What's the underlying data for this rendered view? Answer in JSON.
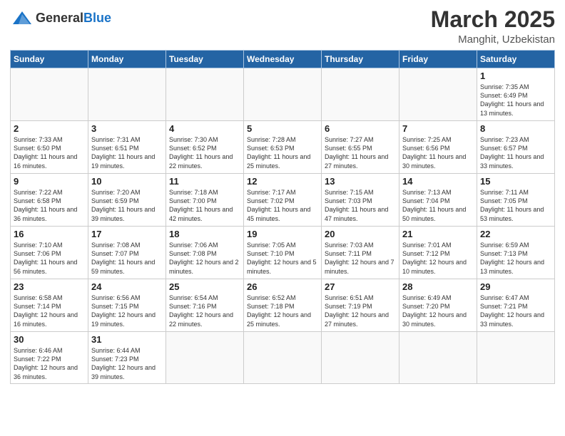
{
  "header": {
    "logo_general": "General",
    "logo_blue": "Blue",
    "month_title": "March 2025",
    "subtitle": "Manghit, Uzbekistan"
  },
  "weekdays": [
    "Sunday",
    "Monday",
    "Tuesday",
    "Wednesday",
    "Thursday",
    "Friday",
    "Saturday"
  ],
  "weeks": [
    [
      {
        "day": "",
        "info": ""
      },
      {
        "day": "",
        "info": ""
      },
      {
        "day": "",
        "info": ""
      },
      {
        "day": "",
        "info": ""
      },
      {
        "day": "",
        "info": ""
      },
      {
        "day": "",
        "info": ""
      },
      {
        "day": "1",
        "info": "Sunrise: 7:35 AM\nSunset: 6:49 PM\nDaylight: 11 hours and 13 minutes."
      }
    ],
    [
      {
        "day": "2",
        "info": "Sunrise: 7:33 AM\nSunset: 6:50 PM\nDaylight: 11 hours and 16 minutes."
      },
      {
        "day": "3",
        "info": "Sunrise: 7:31 AM\nSunset: 6:51 PM\nDaylight: 11 hours and 19 minutes."
      },
      {
        "day": "4",
        "info": "Sunrise: 7:30 AM\nSunset: 6:52 PM\nDaylight: 11 hours and 22 minutes."
      },
      {
        "day": "5",
        "info": "Sunrise: 7:28 AM\nSunset: 6:53 PM\nDaylight: 11 hours and 25 minutes."
      },
      {
        "day": "6",
        "info": "Sunrise: 7:27 AM\nSunset: 6:55 PM\nDaylight: 11 hours and 27 minutes."
      },
      {
        "day": "7",
        "info": "Sunrise: 7:25 AM\nSunset: 6:56 PM\nDaylight: 11 hours and 30 minutes."
      },
      {
        "day": "8",
        "info": "Sunrise: 7:23 AM\nSunset: 6:57 PM\nDaylight: 11 hours and 33 minutes."
      }
    ],
    [
      {
        "day": "9",
        "info": "Sunrise: 7:22 AM\nSunset: 6:58 PM\nDaylight: 11 hours and 36 minutes."
      },
      {
        "day": "10",
        "info": "Sunrise: 7:20 AM\nSunset: 6:59 PM\nDaylight: 11 hours and 39 minutes."
      },
      {
        "day": "11",
        "info": "Sunrise: 7:18 AM\nSunset: 7:00 PM\nDaylight: 11 hours and 42 minutes."
      },
      {
        "day": "12",
        "info": "Sunrise: 7:17 AM\nSunset: 7:02 PM\nDaylight: 11 hours and 45 minutes."
      },
      {
        "day": "13",
        "info": "Sunrise: 7:15 AM\nSunset: 7:03 PM\nDaylight: 11 hours and 47 minutes."
      },
      {
        "day": "14",
        "info": "Sunrise: 7:13 AM\nSunset: 7:04 PM\nDaylight: 11 hours and 50 minutes."
      },
      {
        "day": "15",
        "info": "Sunrise: 7:11 AM\nSunset: 7:05 PM\nDaylight: 11 hours and 53 minutes."
      }
    ],
    [
      {
        "day": "16",
        "info": "Sunrise: 7:10 AM\nSunset: 7:06 PM\nDaylight: 11 hours and 56 minutes."
      },
      {
        "day": "17",
        "info": "Sunrise: 7:08 AM\nSunset: 7:07 PM\nDaylight: 11 hours and 59 minutes."
      },
      {
        "day": "18",
        "info": "Sunrise: 7:06 AM\nSunset: 7:08 PM\nDaylight: 12 hours and 2 minutes."
      },
      {
        "day": "19",
        "info": "Sunrise: 7:05 AM\nSunset: 7:10 PM\nDaylight: 12 hours and 5 minutes."
      },
      {
        "day": "20",
        "info": "Sunrise: 7:03 AM\nSunset: 7:11 PM\nDaylight: 12 hours and 7 minutes."
      },
      {
        "day": "21",
        "info": "Sunrise: 7:01 AM\nSunset: 7:12 PM\nDaylight: 12 hours and 10 minutes."
      },
      {
        "day": "22",
        "info": "Sunrise: 6:59 AM\nSunset: 7:13 PM\nDaylight: 12 hours and 13 minutes."
      }
    ],
    [
      {
        "day": "23",
        "info": "Sunrise: 6:58 AM\nSunset: 7:14 PM\nDaylight: 12 hours and 16 minutes."
      },
      {
        "day": "24",
        "info": "Sunrise: 6:56 AM\nSunset: 7:15 PM\nDaylight: 12 hours and 19 minutes."
      },
      {
        "day": "25",
        "info": "Sunrise: 6:54 AM\nSunset: 7:16 PM\nDaylight: 12 hours and 22 minutes."
      },
      {
        "day": "26",
        "info": "Sunrise: 6:52 AM\nSunset: 7:18 PM\nDaylight: 12 hours and 25 minutes."
      },
      {
        "day": "27",
        "info": "Sunrise: 6:51 AM\nSunset: 7:19 PM\nDaylight: 12 hours and 27 minutes."
      },
      {
        "day": "28",
        "info": "Sunrise: 6:49 AM\nSunset: 7:20 PM\nDaylight: 12 hours and 30 minutes."
      },
      {
        "day": "29",
        "info": "Sunrise: 6:47 AM\nSunset: 7:21 PM\nDaylight: 12 hours and 33 minutes."
      }
    ],
    [
      {
        "day": "30",
        "info": "Sunrise: 6:46 AM\nSunset: 7:22 PM\nDaylight: 12 hours and 36 minutes."
      },
      {
        "day": "31",
        "info": "Sunrise: 6:44 AM\nSunset: 7:23 PM\nDaylight: 12 hours and 39 minutes."
      },
      {
        "day": "",
        "info": ""
      },
      {
        "day": "",
        "info": ""
      },
      {
        "day": "",
        "info": ""
      },
      {
        "day": "",
        "info": ""
      },
      {
        "day": "",
        "info": ""
      }
    ]
  ]
}
